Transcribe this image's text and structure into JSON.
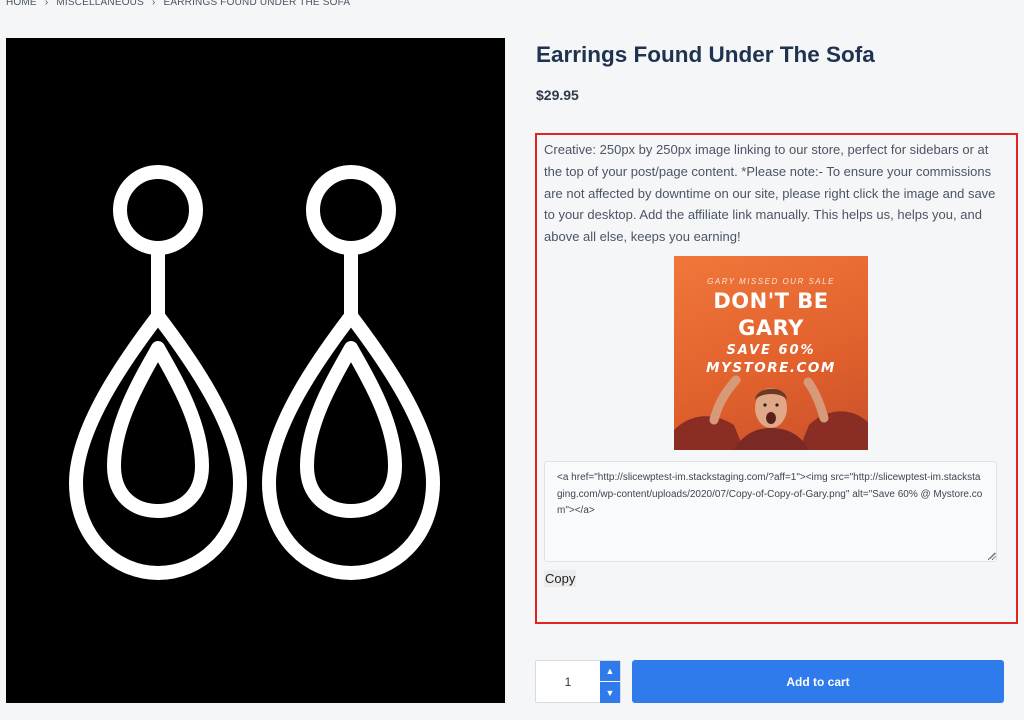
{
  "breadcrumb": {
    "items": [
      "HOME",
      "MISCELLANEOUS",
      "EARRINGS FOUND UNDER THE SOFA"
    ],
    "separator": ">"
  },
  "product": {
    "title": "Earrings Found Under The Sofa",
    "price": "$29.95",
    "image_icon": "earrings-icon"
  },
  "creative": {
    "description": "Creative: 250px by 250px image linking to our store, perfect for sidebars or at the top of your post/page content. *Please note:- To ensure your commissions are not affected by downtime on our site, please right click the image and save to your desktop. Add the affiliate link manually. This helps us, helps you, and above all else, keeps you earning!",
    "banner": {
      "top_line": "GARY MISSED OUR SALE",
      "headline_1": "DON'T BE",
      "headline_2": "GARY",
      "save": "SAVE 60%",
      "store": "MYSTORE.COM"
    },
    "code": "<a href=\"http://slicewptest-im.stackstaging.com/?aff=1\"><img src=\"http://slicewptest-im.stackstaging.com/wp-content/uploads/2020/07/Copy-of-Copy-of-Gary.png\" alt=\"Save 60% @ Mystore.com\"></a>",
    "copy_label": "Copy"
  },
  "cart": {
    "quantity": "1",
    "add_label": "Add to cart"
  },
  "colors": {
    "accent": "#2f7bec",
    "highlight_border": "#e02424",
    "title": "#1f3350",
    "banner": "#e8692f"
  }
}
